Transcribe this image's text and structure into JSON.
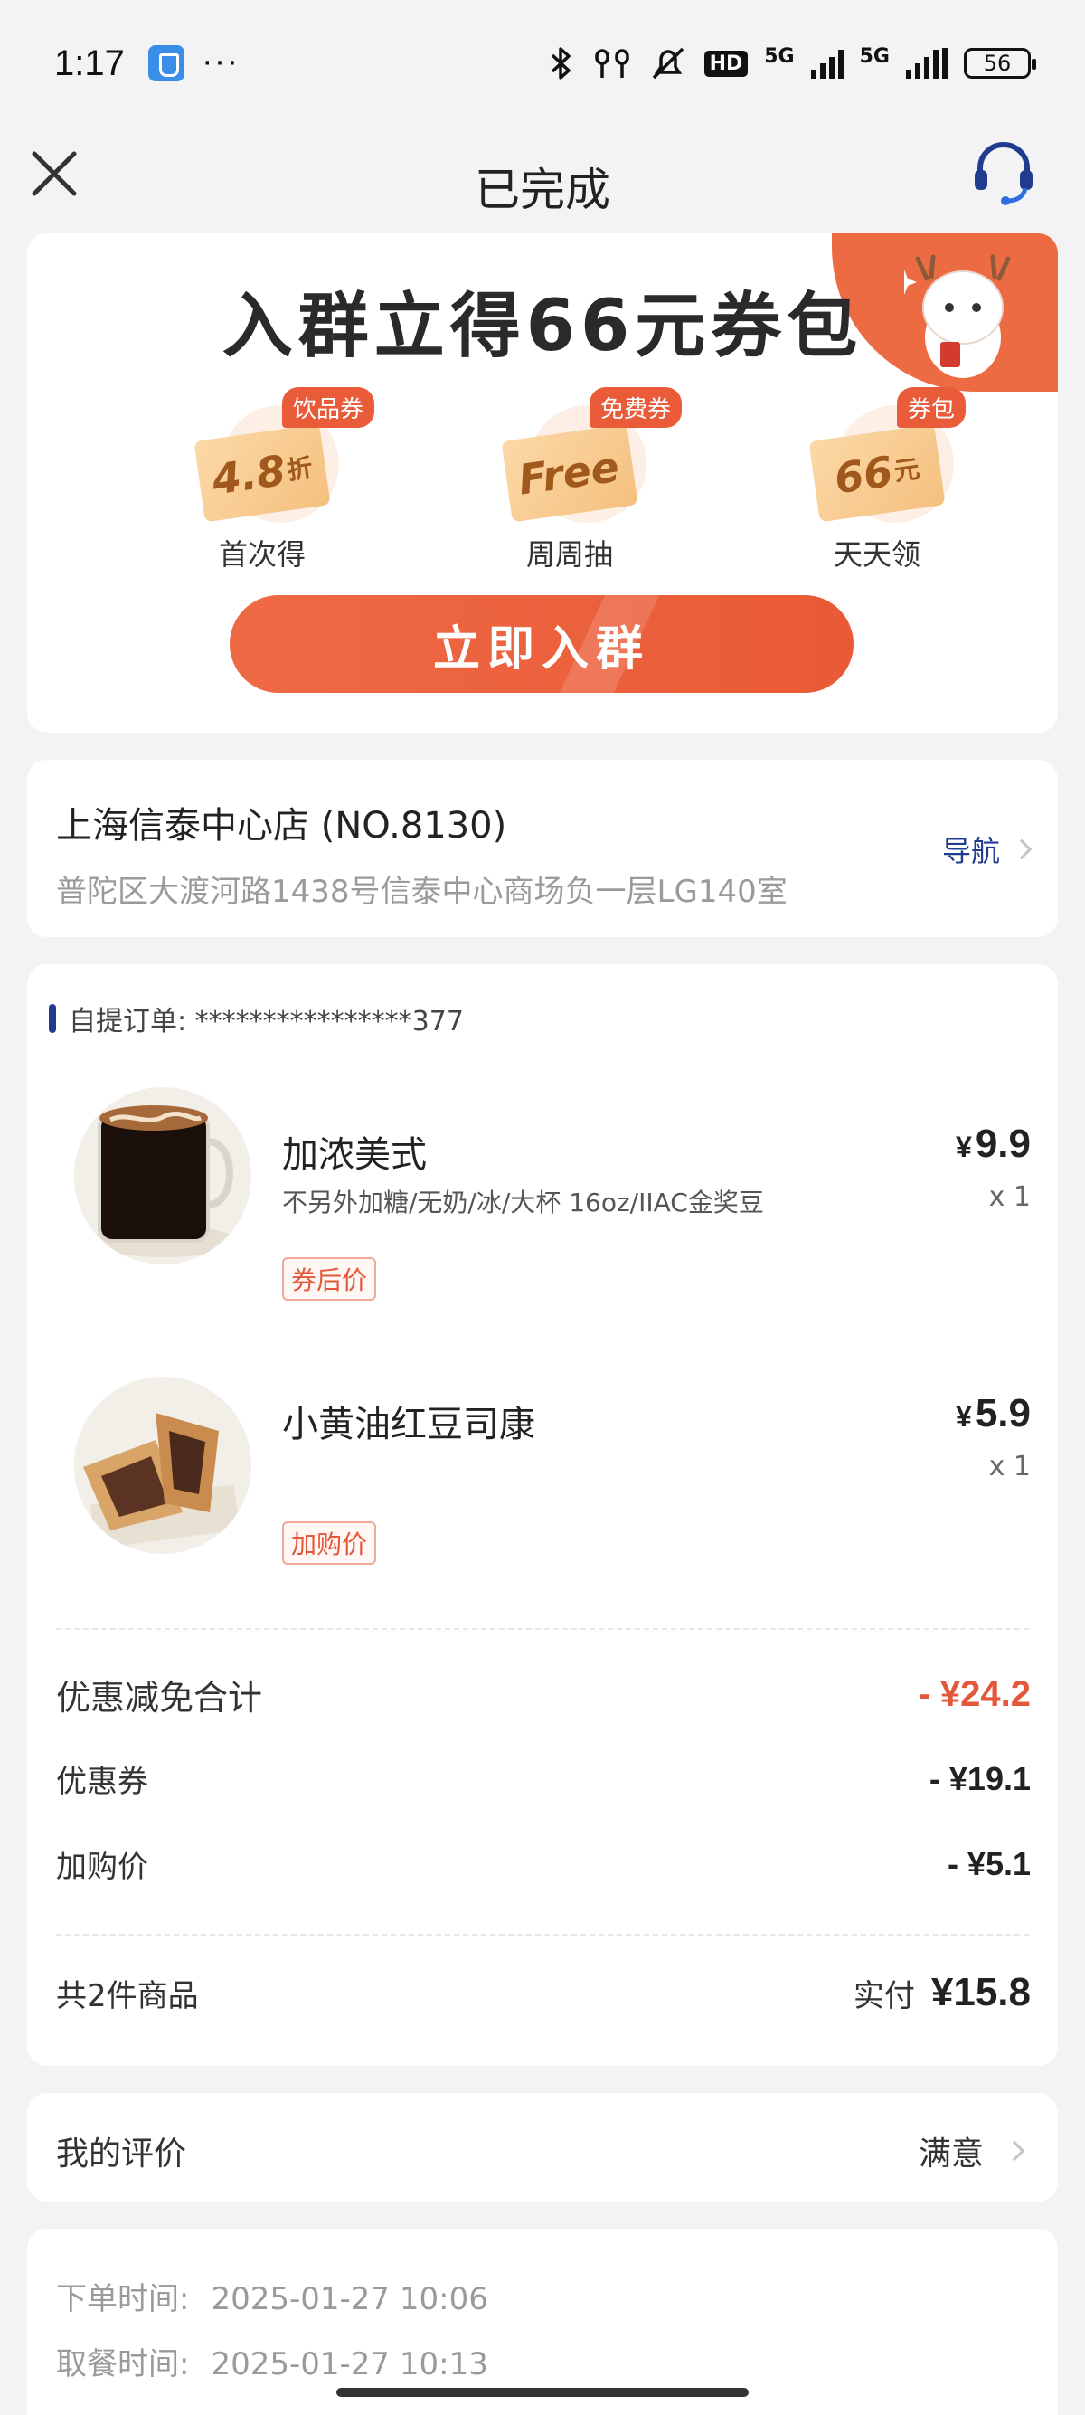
{
  "status_bar": {
    "time": "1:17",
    "dots": "···",
    "hd_label": "HD",
    "network_1": "5G",
    "network_2": "5G",
    "battery": "56"
  },
  "navbar": {
    "title": "已完成"
  },
  "promo": {
    "headline": "入群立得66元券包",
    "perks": [
      {
        "tag": "饮品券",
        "ticket_main": "4.8",
        "ticket_unit": "折",
        "caption": "首次得"
      },
      {
        "tag": "免费券",
        "ticket_main": "Free",
        "ticket_unit": "",
        "caption": "周周抽"
      },
      {
        "tag": "券包",
        "ticket_main": "66",
        "ticket_unit": "元",
        "caption": "天天领"
      }
    ],
    "join_button": "立即入群",
    "accent_color": "#ec6b43"
  },
  "store": {
    "name": "上海信泰中心店 (NO.8130)",
    "address": "普陀区大渡河路1438号信泰中心商场负一层LG140室",
    "nav_label": "导航",
    "link_color": "#1f3c8f"
  },
  "order": {
    "number_label": "自提订单: ****************377",
    "items": [
      {
        "name": "加浓美式",
        "specs": "不另外加糖/无奶/冰/大杯 16oz/IIAC金奖豆",
        "tag": "券后价",
        "currency": "¥",
        "price": "9.9",
        "qty": "x 1"
      },
      {
        "name": "小黄油红豆司康",
        "specs": "",
        "tag": "加购价",
        "currency": "¥",
        "price": "5.9",
        "qty": "x 1"
      }
    ],
    "discount_total": {
      "label": "优惠减免合计",
      "value": "- ¥24.2"
    },
    "discounts": [
      {
        "label": "优惠券",
        "value": "- ¥19.1"
      },
      {
        "label": "加购价",
        "value": "- ¥5.1"
      }
    ],
    "summary": {
      "count_label": "共2件商品",
      "paid_label": "实付",
      "paid_value": "¥15.8"
    },
    "discount_color": "#e4573a"
  },
  "review": {
    "label": "我的评价",
    "value": "满意"
  },
  "times": {
    "order_time_label": "下单时间:",
    "order_time": "2025-01-27 10:06",
    "pickup_time_label": "取餐时间:",
    "pickup_time": "2025-01-27 10:13"
  }
}
